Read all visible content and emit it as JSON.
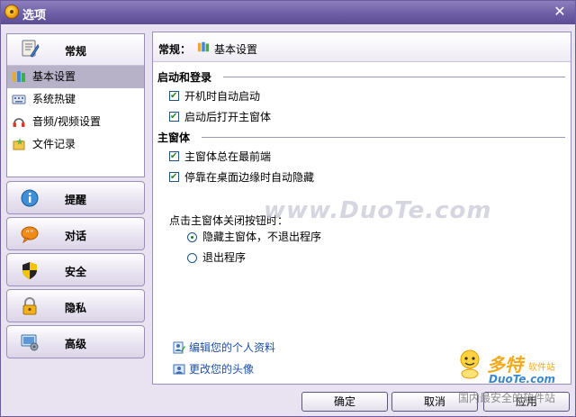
{
  "window": {
    "title": "选项",
    "close_symbol": "✕",
    "title_icon": "app-logo-icon"
  },
  "nav": {
    "expanded": {
      "label": "常规",
      "icon": "general-settings-icon",
      "items": [
        {
          "label": "基本设置",
          "icon": "basic-settings-icon",
          "selected": true
        },
        {
          "label": "系统热键",
          "icon": "hotkey-icon",
          "selected": false
        },
        {
          "label": "音频/视频设置",
          "icon": "headset-icon",
          "selected": false
        },
        {
          "label": "文件记录",
          "icon": "file-record-icon",
          "selected": false
        }
      ]
    },
    "groups": [
      {
        "label": "提醒",
        "icon": "info-icon"
      },
      {
        "label": "对话",
        "icon": "chat-bubble-icon"
      },
      {
        "label": "安全",
        "icon": "shield-icon"
      },
      {
        "label": "隐私",
        "icon": "lock-icon"
      },
      {
        "label": "高级",
        "icon": "advanced-settings-icon"
      }
    ]
  },
  "content": {
    "breadcrumb": {
      "label": "常规：",
      "page": "基本设置"
    },
    "sections": {
      "startup": {
        "title": "启动和登录",
        "options": [
          {
            "label": "开机时自动启动",
            "checked": true
          },
          {
            "label": "启动后打开主窗体",
            "checked": true
          }
        ]
      },
      "main_window": {
        "title": "主窗体",
        "options": [
          {
            "label": "主窗体总在最前端",
            "checked": true
          },
          {
            "label": "停靠在桌面边缘时自动隐藏",
            "checked": true
          }
        ]
      }
    },
    "close_behavior": {
      "prompt": "点击主窗体关闭按钮时：",
      "options": [
        {
          "label": "隐藏主窗体，不退出程序",
          "selected": true
        },
        {
          "label": "退出程序",
          "selected": false
        }
      ]
    },
    "links": [
      {
        "label": "编辑您的个人资料",
        "icon": "edit-profile-icon"
      },
      {
        "label": "更改您的头像",
        "icon": "avatar-icon"
      }
    ]
  },
  "buttons": {
    "ok": "确定",
    "cancel": "取消",
    "apply": "应用"
  },
  "watermark": {
    "center": "www.DuoTe.com",
    "logo": "多特",
    "logo_sub": "软件站",
    "domain": "DuoTe.com",
    "tagline": "国内最安全的软件站"
  }
}
